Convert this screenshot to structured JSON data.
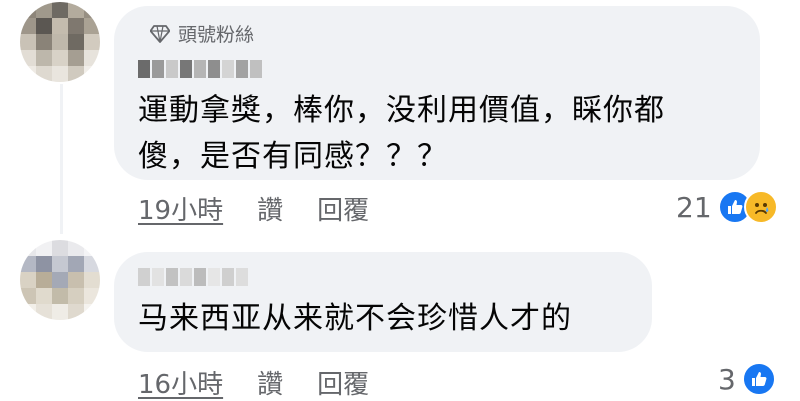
{
  "comments": [
    {
      "badge": "頭號粉絲",
      "text_lines": [
        "運動拿獎，棒你，没利用價值，睬你都",
        "傻，是否有同感？？？"
      ],
      "time": "19小時",
      "like_label": "讚",
      "reply_label": "回覆",
      "reaction_count": "21",
      "reactions": [
        "like-icon",
        "sad-icon"
      ]
    },
    {
      "text_lines": [
        "马来西亚从来就不会珍惜人才的"
      ],
      "time": "16小時",
      "like_label": "讚",
      "reply_label": "回覆",
      "reaction_count": "3",
      "reactions": [
        "like-icon"
      ]
    }
  ],
  "colors": {
    "bubble": "#f0f2f5",
    "like_blue": "#1877f2",
    "sad_yellow": "#f7b928",
    "meta_grey": "#65676b"
  }
}
